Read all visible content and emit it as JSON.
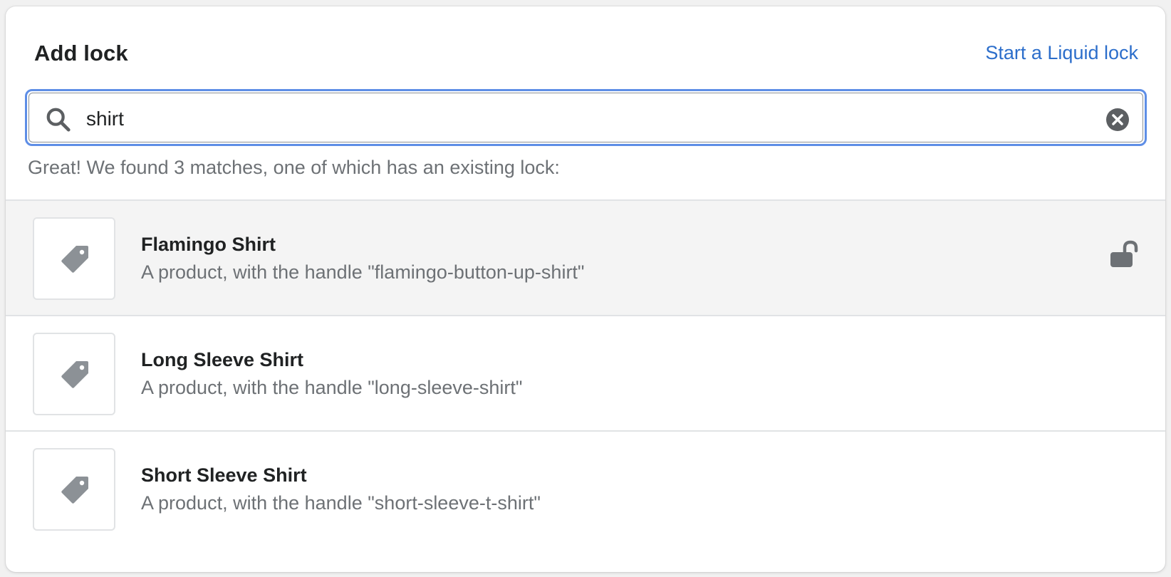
{
  "header": {
    "title": "Add lock",
    "liquid_link": "Start a Liquid lock"
  },
  "search": {
    "value": "shirt",
    "placeholder": "",
    "icon": "search-icon",
    "clear_icon": "clear-circle-icon"
  },
  "results_message": "Great! We found 3 matches, one of which has an existing lock:",
  "results": [
    {
      "title": "Flamingo Shirt",
      "description": "A product, with the handle \"flamingo-button-up-shirt\"",
      "icon": "tag-icon",
      "status_icon": "unlocked-icon"
    },
    {
      "title": "Long Sleeve Shirt",
      "description": "A product, with the handle \"long-sleeve-shirt\"",
      "icon": "tag-icon"
    },
    {
      "title": "Short Sleeve Shirt",
      "description": "A product, with the handle \"short-sleeve-t-shirt\"",
      "icon": "tag-icon"
    }
  ],
  "colors": {
    "link": "#2c6ecb",
    "focus_ring": "#5e8ee6",
    "icon": "#8c9196",
    "highlight_row": "#f4f4f4"
  }
}
